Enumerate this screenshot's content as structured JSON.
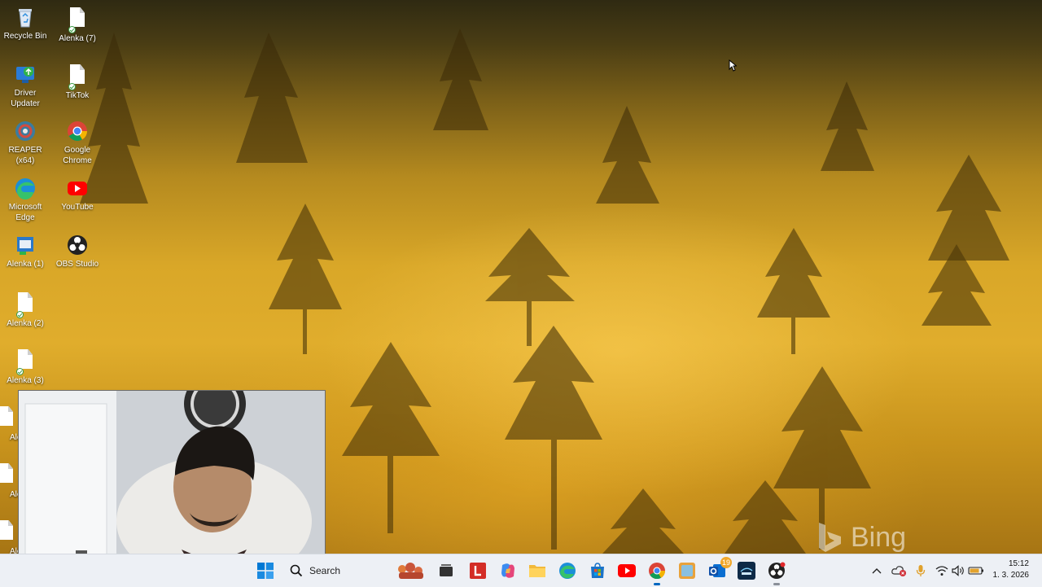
{
  "desktop": {
    "icons": [
      {
        "label": "Recycle Bin",
        "icon": "recycle-bin-icon"
      },
      {
        "label": "Alenka  (7)",
        "icon": "document-icon"
      },
      {
        "label": "Driver Updater",
        "icon": "driver-updater-icon"
      },
      {
        "label": "TikTok",
        "icon": "document-icon"
      },
      {
        "label": "REAPER (x64)",
        "icon": "reaper-icon"
      },
      {
        "label": "Google Chrome",
        "icon": "chrome-icon"
      },
      {
        "label": "Microsoft Edge",
        "icon": "edge-icon"
      },
      {
        "label": "YouTube",
        "icon": "youtube-icon"
      },
      {
        "label": "Alenka  (1)",
        "icon": "document-icon"
      },
      {
        "label": "OBS Studio",
        "icon": "obs-icon"
      },
      {
        "label": "Alenka  (2)",
        "icon": "document-icon"
      },
      {
        "label": "Alenka  (3)",
        "icon": "document-icon"
      },
      {
        "label": "Ale",
        "icon": "document-icon"
      },
      {
        "label": "Ale",
        "icon": "document-icon"
      },
      {
        "label": "Ale",
        "icon": "document-icon"
      }
    ],
    "watermark": "Bing"
  },
  "webcam": {
    "label": "webcam-overlay"
  },
  "taskbar": {
    "search_label": "Search",
    "apps": [
      "start-icon",
      "search-icon",
      "widgets-icon",
      "task-view-icon",
      "lastpass-icon",
      "copilot-icon",
      "file-explorer-icon",
      "edge-icon",
      "microsoft-store-icon",
      "youtube-icon",
      "chrome-icon",
      "photos-icon",
      "outlook-icon",
      "disney-plus-icon",
      "obs-icon"
    ],
    "outlook_badge": "19",
    "clock_time": "15:12",
    "clock_date": "1. 3. 2026"
  },
  "colors": {
    "taskbar_bg": "#edf0f5",
    "wallpaper_gold": "#e0ad2c",
    "accent": "#0067c0"
  }
}
